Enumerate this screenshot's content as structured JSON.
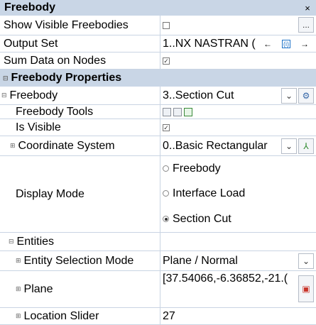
{
  "panel": {
    "title": "Freebody",
    "close_glyph": "×"
  },
  "rows": {
    "show_visible": {
      "label": "Show Visible Freebodies",
      "checked": false,
      "button_glyph": "..."
    },
    "output_set": {
      "label": "Output Set",
      "value": "1..NX NASTRAN ("
    },
    "sum_data": {
      "label": "Sum Data on Nodes",
      "checked": true
    },
    "freebody_props": {
      "label": "Freebody Properties",
      "expander": "⊟"
    },
    "freebody": {
      "label": "Freebody",
      "value": "3..Section Cut",
      "expander": "⊟"
    },
    "freebody_tools": {
      "label": "Freebody Tools"
    },
    "is_visible": {
      "label": "Is Visible",
      "checked": true
    },
    "coord_sys": {
      "label": "Coordinate System",
      "value": "0..Basic Rectangular",
      "expander": "⊞"
    },
    "display_mode": {
      "label": "Display Mode",
      "options": [
        "Freebody",
        "Interface Load",
        "Section Cut"
      ],
      "selected": "Section Cut"
    },
    "entities": {
      "label": "Entities",
      "expander": "⊟"
    },
    "entity_sel": {
      "label": "Entity Selection Mode",
      "value": "Plane / Normal",
      "expander": "⊞"
    },
    "plane": {
      "label": "Plane",
      "value": "[37.54066,-6.36852,-21.(",
      "expander": "⊞"
    },
    "location": {
      "label": "Location Slider",
      "value": "27",
      "expander": "⊞"
    }
  },
  "colors": {
    "header_bg": "#c9d6e6",
    "grid_line": "#c9d4e3",
    "accent_blue": "#1e73c8",
    "accent_red": "#c8342a"
  },
  "icons": [
    "close-icon",
    "ellipsis-icon",
    "arrow-left-icon",
    "vector-icon",
    "arrow-right-icon",
    "chevron-down-icon",
    "settings-icon",
    "tool-icon",
    "axes-icon",
    "pick-icon",
    "expand-icon",
    "collapse-icon"
  ]
}
